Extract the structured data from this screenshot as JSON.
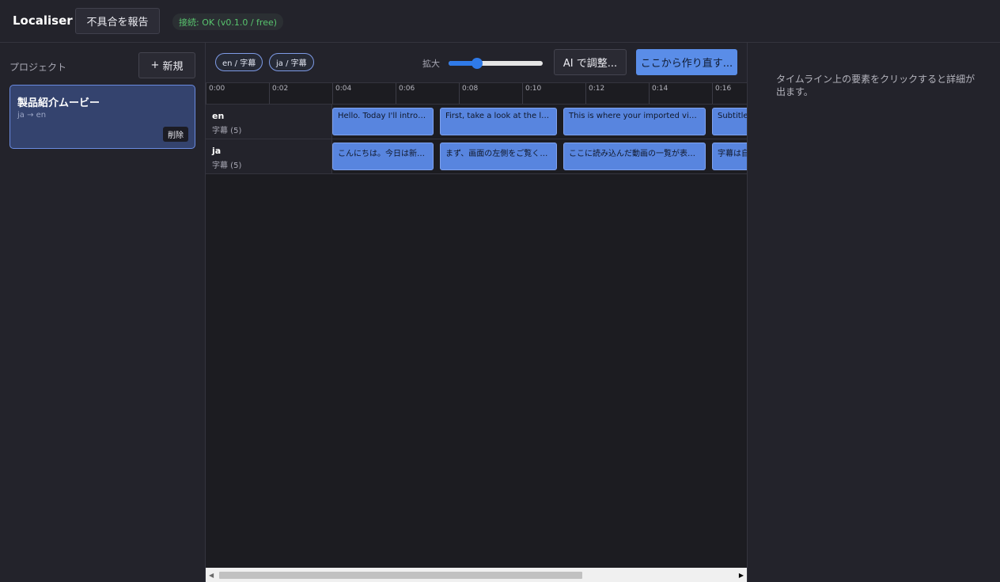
{
  "header": {
    "app_title": "Localiser",
    "report_button": "不具合を報告",
    "status": "接続: OK (v0.1.0 / free)"
  },
  "sidebar": {
    "title": "プロジェクト",
    "new_button_icon": "plus-icon",
    "new_button_plus": "+",
    "new_button_label": "新規",
    "projects": [
      {
        "name": "製品紹介ムービー",
        "langs": "ja → en",
        "delete_label": "削除"
      }
    ]
  },
  "toolbar": {
    "chips": [
      "en / 字幕",
      "ja / 字幕"
    ],
    "zoom_label": "拡大",
    "zoom_value": 0.3,
    "ai_button": "AI で調整...",
    "rebuild_button": "ここから作り直す..."
  },
  "timeline": {
    "ticks": [
      "0:00",
      "0:02",
      "0:04",
      "0:06",
      "0:08",
      "0:10",
      "0:12",
      "0:14",
      "0:16"
    ],
    "tracks": [
      {
        "name": "en",
        "sub": "字幕 (5)",
        "clips": [
          "Hello. Today I'll introd...",
          "First, take a look at the lef...",
          "This is where your imported vid...",
          "Subtitle"
        ]
      },
      {
        "name": "ja",
        "sub": "字幕 (5)",
        "clips": [
          "こんにちは。今日は新し...",
          "まず、画面の左側をご覧くだ...",
          "ここに読み込んだ動画の一覧が表示...",
          "字幕は自"
        ]
      }
    ]
  },
  "scrollbar": {
    "left_arrow": "◀",
    "right_arrow": "▶",
    "thumb_fraction": 0.67
  },
  "detail": {
    "placeholder": "タイムライン上の要素をクリックすると詳細が出ます。"
  },
  "colors": {
    "accent": "#5a8de8",
    "clip": "#5885df",
    "status_ok": "#58c46e",
    "background": "#1c1c21",
    "panel": "#23232b"
  }
}
